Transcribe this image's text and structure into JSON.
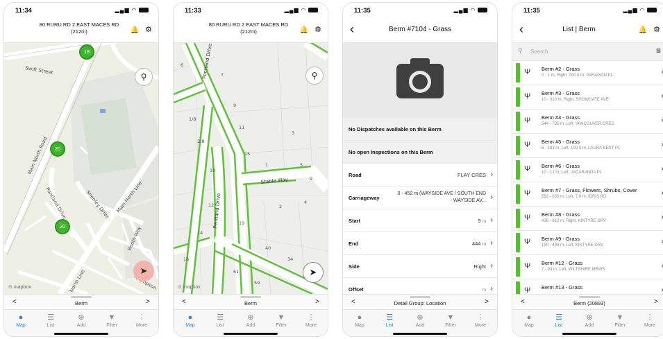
{
  "colors": {
    "accent": "#2d87d6",
    "green": "#52c12a",
    "nav_active": "#f4b3ad"
  },
  "icons": {
    "bell": "bell-icon",
    "gear": "gear-icon",
    "search": "search-icon",
    "navigate": "location-arrow-icon",
    "camera": "camera-icon",
    "grass": "grass-icon",
    "chevron": "chevron-right-icon",
    "back": "chevron-left-icon",
    "sort": "sort-icon"
  },
  "screen1": {
    "time": "11:34",
    "address": "80 RURU RD 2 EAST MACES RD",
    "distance": "(212m)",
    "street_labels": [
      "Swift Street",
      "Main North Road",
      "Pentland Drive",
      "Shenley Drive",
      "Main North Line",
      "Booth Way",
      "North Line",
      "Thompson"
    ],
    "clusters": [
      "18",
      "20",
      "20"
    ],
    "attribution": "mapbox",
    "pager_label": "Berm"
  },
  "screen2": {
    "time": "11:33",
    "address": "80 RURU RD 2 EAST MACES RD",
    "distance": "(212m)",
    "street_labels": [
      "Pentland Drive",
      "Stable Way",
      "Pentland Drive"
    ],
    "parcel_numbers": [
      "6",
      "7",
      "9",
      "1/8",
      "11",
      "3",
      "2/8",
      "15",
      "10",
      "1",
      "5",
      "9",
      "12",
      "2",
      "4",
      "19",
      "14",
      "40",
      "16",
      "34",
      "61",
      "59"
    ],
    "attribution": "mapbox",
    "pager_label": "Berm"
  },
  "screen3": {
    "time": "11:35",
    "title": "Berm #7104 - Grass",
    "notes": [
      "No Dispatches available on this Berm",
      "No open Inspections on this Berm"
    ],
    "rows": [
      {
        "key": "Road",
        "value": "FLAY CRES"
      },
      {
        "key": "Carriageway",
        "value": "0 - 452 m (WAYSIDE AVE / SOUTH END - WAYSIDE AV..."
      },
      {
        "key": "Start",
        "value": "9",
        "unit": "m"
      },
      {
        "key": "End",
        "value": "444",
        "unit": "m"
      },
      {
        "key": "Side",
        "value": "Right"
      },
      {
        "key": "Offset",
        "value": "",
        "unit": "m"
      }
    ],
    "pager_label": "Detail Group: Location"
  },
  "screen4": {
    "time": "11:35",
    "title": "List | Berm",
    "search_placeholder": "Search",
    "items": [
      {
        "name": "Berm #2 - Grass",
        "sub": "0 - 1 m, Right, 200.0 m, PARAGON PL"
      },
      {
        "name": "Berm #3 - Grass",
        "sub": "10 - 310 m, Right, SHOWGATE AVE"
      },
      {
        "name": "Berm #4 - Grass",
        "sub": "544 - 735 m, Left, VANCOUVER CRES"
      },
      {
        "name": "Berm #5 - Grass",
        "sub": "6 - 183 m, Left, 100.0 m, LAURA KENT PL"
      },
      {
        "name": "Berm #6 - Grass",
        "sub": "10 - 12 m, Left, JACARANDA PL"
      },
      {
        "name": "Berm #7 - Grass, Flowers, Shrubs, Cover",
        "sub": "582 - 633 m, Left, 7.0 m, IDRIS RD"
      },
      {
        "name": "Berm #8 - Grass",
        "sub": "436 - 612 m, Right, KINTYRE DRV"
      },
      {
        "name": "Berm #9 - Grass",
        "sub": "190 - 436 m, Left, KINTYRE DRV"
      },
      {
        "name": "Berm #12 - Grass",
        "sub": "7 - 93 m, Left, WILTSHIRE MEWS"
      },
      {
        "name": "Berm #13 - Grass",
        "sub": ""
      }
    ],
    "pager_label": "Berm (20893)"
  },
  "tabs": [
    "Map",
    "List",
    "Add",
    "Filter",
    "More"
  ]
}
